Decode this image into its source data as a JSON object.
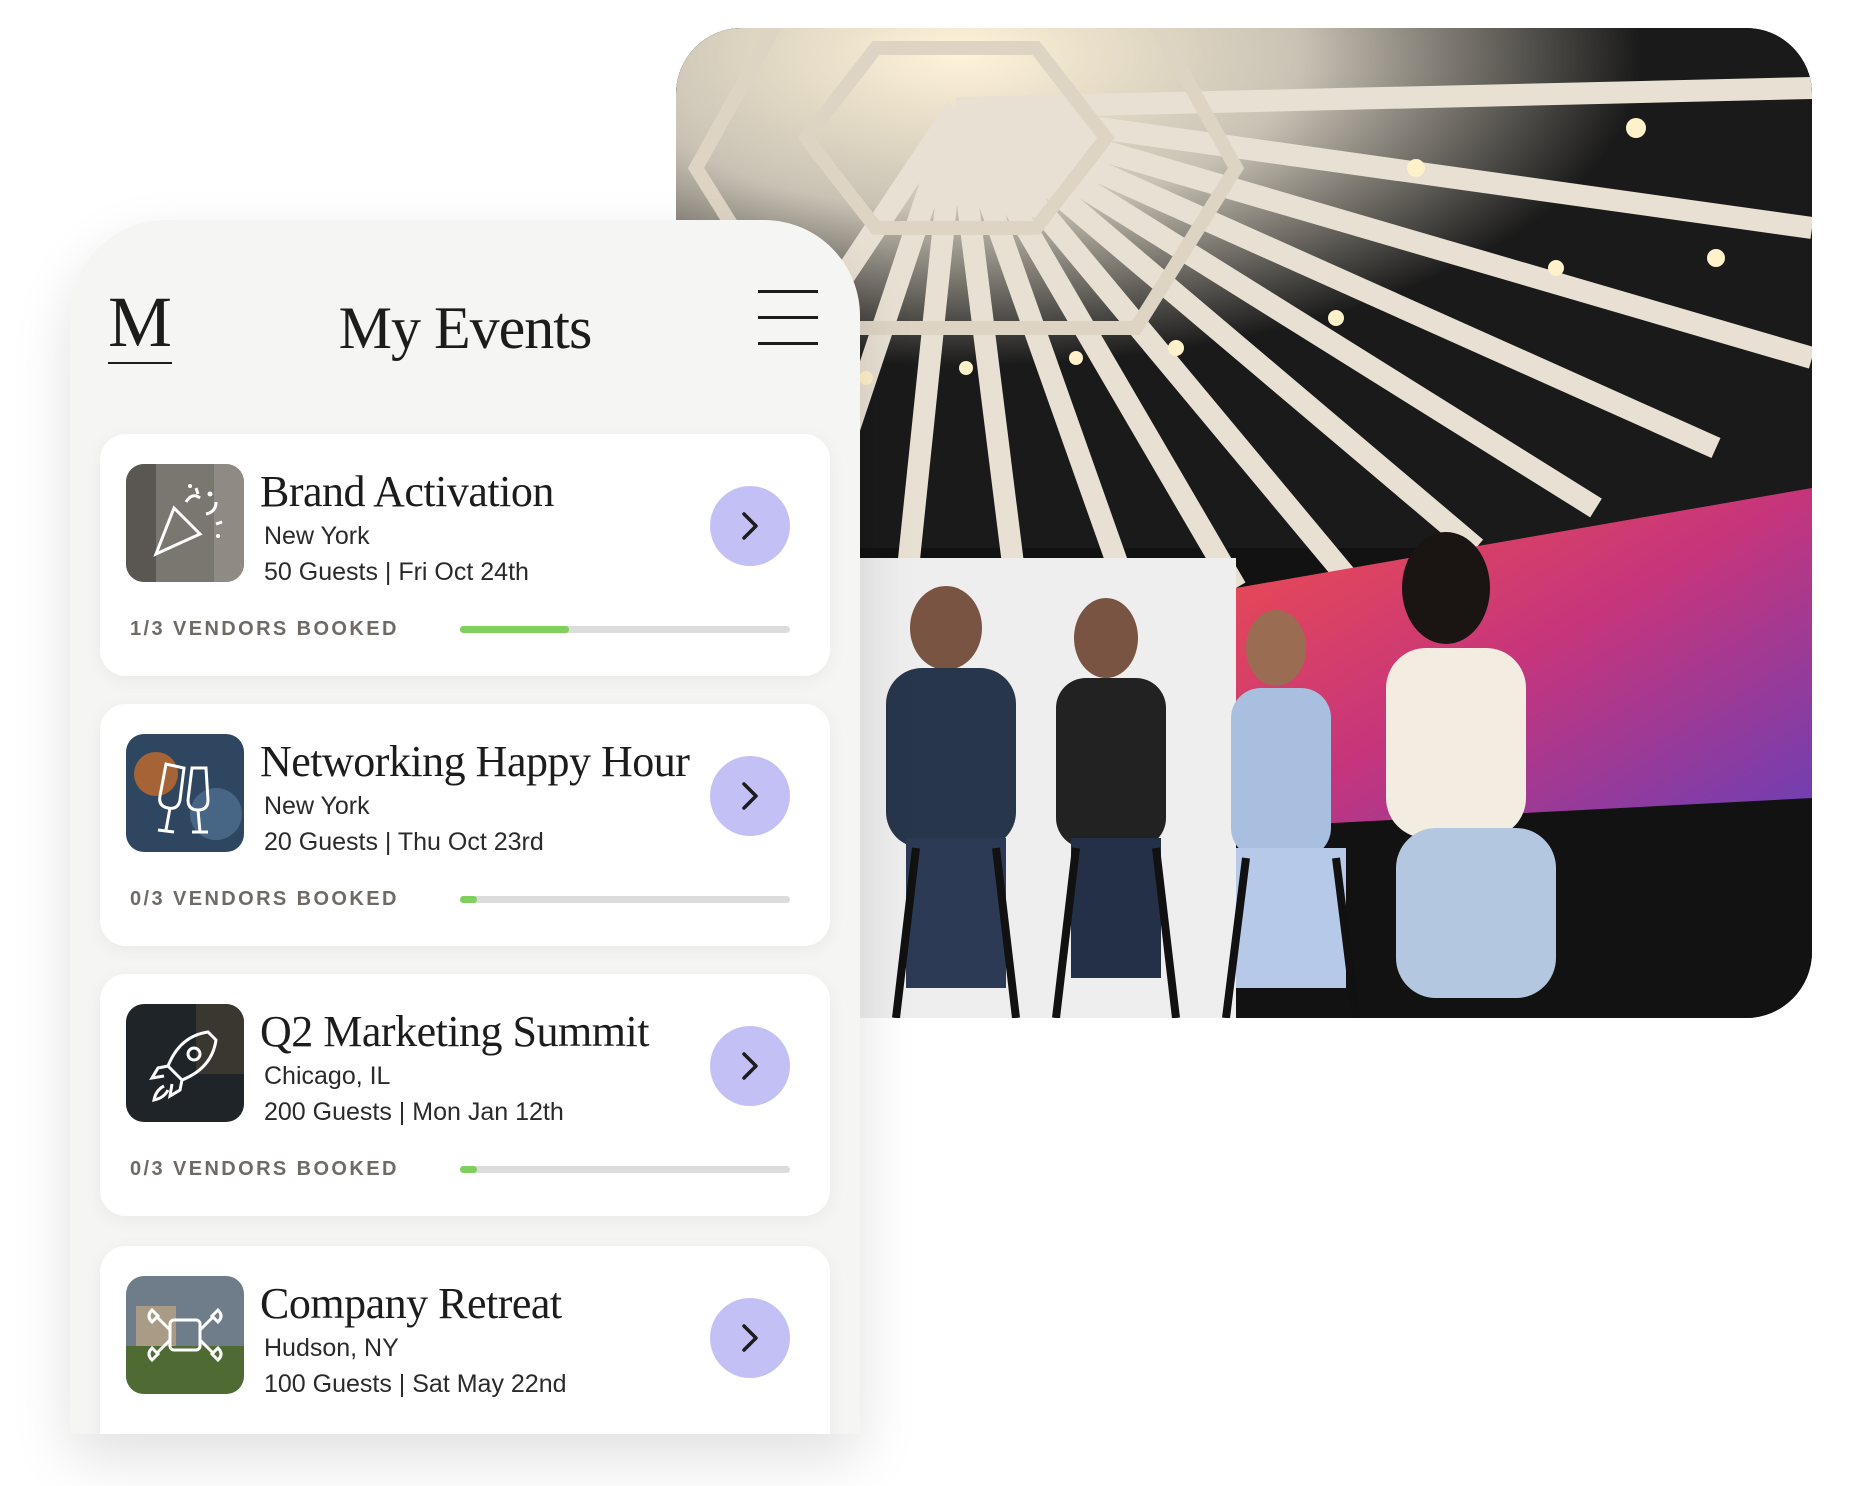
{
  "header": {
    "logo": "M",
    "title": "My Events"
  },
  "events": [
    {
      "title": "Brand Activation",
      "location": "New York",
      "details": "50 Guests | Fri Oct 24th",
      "vendors": "1/3 VENDORS BOOKED",
      "progress": 0.33,
      "thumb_icon": "party-popper-icon"
    },
    {
      "title": "Networking Happy Hour",
      "location": "New York",
      "details": "20 Guests | Thu Oct 23rd",
      "vendors": "0/3 VENDORS BOOKED",
      "progress": 0.05,
      "thumb_icon": "champagne-glasses-icon"
    },
    {
      "title": "Q2 Marketing Summit",
      "location": "Chicago, IL",
      "details": "200 Guests | Mon Jan 12th",
      "vendors": "0/3 VENDORS BOOKED",
      "progress": 0.05,
      "thumb_icon": "rocket-icon"
    },
    {
      "title": "Company Retreat",
      "location": "Hudson, NY",
      "details": "100 Guests | Sat May 22nd",
      "vendors": "",
      "progress": null,
      "thumb_icon": "team-hands-icon"
    }
  ],
  "photo": {
    "description_icon": "event-panel-photo"
  },
  "colors": {
    "panel_background": "#f5f5f3",
    "card_background": "#ffffff",
    "accent_button": "#c3c0f6",
    "progress_fill": "#7fcf5c",
    "progress_track": "#dcdcdc",
    "label_gray": "#6e6a66"
  }
}
